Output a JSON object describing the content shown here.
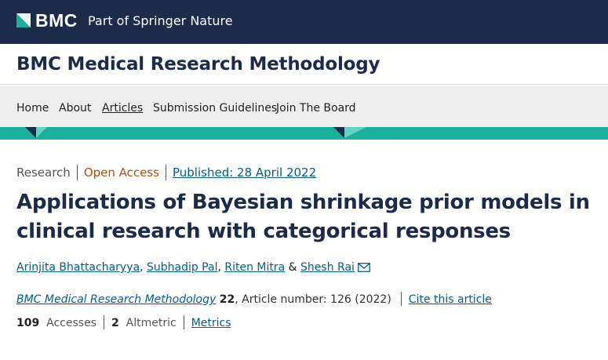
{
  "header": {
    "logo_text": "BMC",
    "tagline": "Part of Springer Nature",
    "colors": {
      "background": "#1c2b4a",
      "logo_mark": "#1ab09c"
    }
  },
  "journal": {
    "title": "BMC Medical Research Methodology"
  },
  "nav": {
    "items": [
      {
        "label": "Home"
      },
      {
        "label": "About"
      },
      {
        "label": "Articles"
      },
      {
        "label": "Submission Guidelines"
      },
      {
        "label": "Join The Board"
      }
    ],
    "active": "Articles"
  },
  "article": {
    "type": "Research",
    "access": "Open Access",
    "published": "Published: 28 April 2022",
    "title": "Applications of Bayesian shrinkage prior models in clinical research with categorical responses",
    "authors": [
      {
        "name": "Arinjita Bhattacharyya"
      },
      {
        "name": "Subhadip Pal"
      },
      {
        "name": "Riten Mitra"
      },
      {
        "name": "Shesh Rai"
      }
    ],
    "author_sep_comma": ", ",
    "author_sep_and": " & ",
    "contact_icon": "mail-icon",
    "citation": {
      "journal": "BMC Medical Research Methodology",
      "volume": "22",
      "article_number": ", Article number: 126 (2022)",
      "cite_label": "Cite this article"
    },
    "metrics": {
      "accesses_count": "109",
      "accesses_label": "Accesses",
      "altmetric_count": "2",
      "altmetric_label": "Altmetric",
      "metrics_link": "Metrics"
    }
  },
  "colors": {
    "accent_teal": "#1ab09c",
    "navy": "#1c2b4a",
    "link_blue": "#025e8d",
    "open_access_orange": "#b44d0e"
  }
}
